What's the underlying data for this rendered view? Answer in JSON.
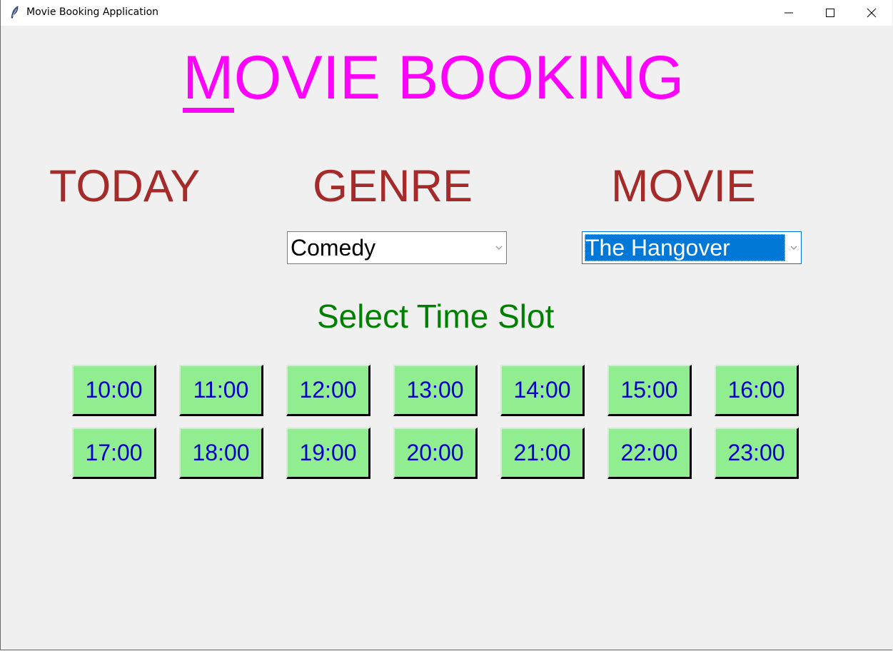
{
  "window": {
    "title": "Movie Booking Application",
    "controls": {
      "minimize": "minimize-icon",
      "maximize": "maximize-icon",
      "close": "close-icon"
    }
  },
  "header": {
    "title_first": "M",
    "title_rest": "OVIE BOOKING",
    "color": "#ff00ff"
  },
  "labels": {
    "today": "TODAY",
    "genre": "GENRE",
    "movie": "MOVIE",
    "color": "#a52a2a"
  },
  "genre_select": {
    "value": "Comedy"
  },
  "movie_select": {
    "value": "The Hangover",
    "highlight_color": "#0078d7"
  },
  "time_slot": {
    "heading": "Select Time Slot",
    "heading_color": "#008000",
    "button_color": "#90ee90",
    "text_color": "#0000cd",
    "slots": [
      "10:00",
      "11:00",
      "12:00",
      "13:00",
      "14:00",
      "15:00",
      "16:00",
      "17:00",
      "18:00",
      "19:00",
      "20:00",
      "21:00",
      "22:00",
      "23:00"
    ]
  }
}
